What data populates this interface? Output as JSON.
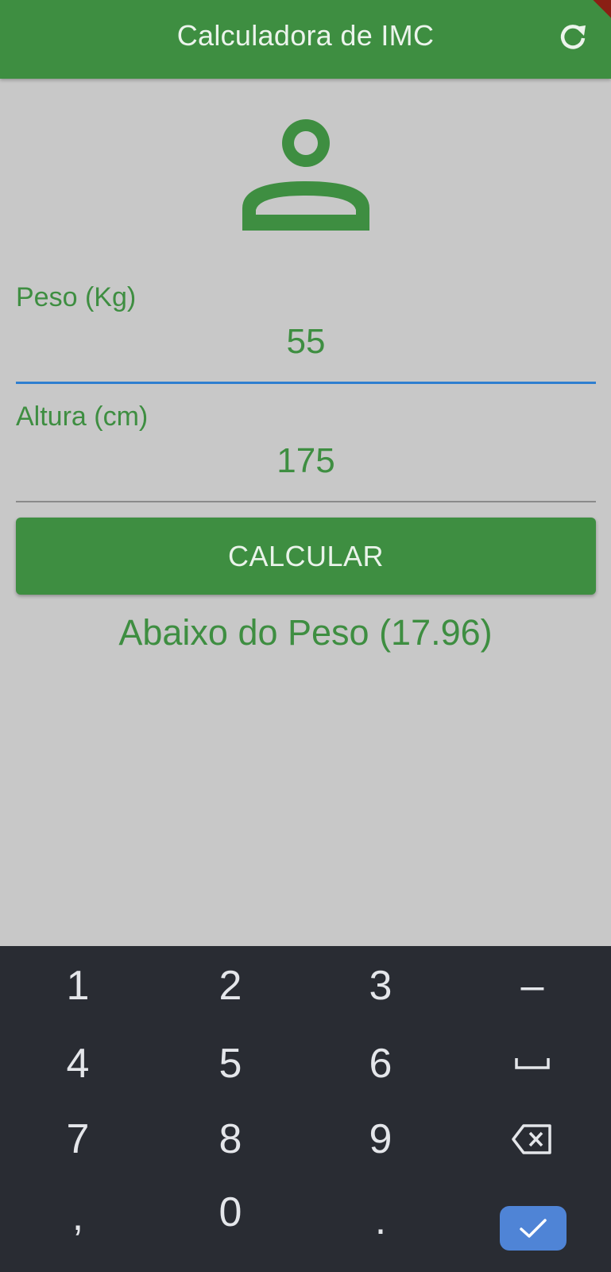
{
  "appbar": {
    "title": "Calculadora de IMC",
    "refresh_icon": "refresh-icon",
    "color": "#3e8e41"
  },
  "avatar_icon": "person-outline-icon",
  "form": {
    "weight": {
      "label": "Peso (Kg)",
      "value": "55"
    },
    "height": {
      "label": "Altura (cm)",
      "value": "175"
    },
    "calculate_label": "CALCULAR"
  },
  "result": {
    "text": "Abaixo do Peso (17.96)"
  },
  "keyboard": {
    "rows": [
      [
        "1",
        "2",
        "3",
        "–"
      ],
      [
        "4",
        "5",
        "6",
        "space"
      ],
      [
        "7",
        "8",
        "9",
        "backspace"
      ],
      [
        ",",
        "0",
        ".",
        "done"
      ]
    ],
    "keys": {
      "k1": "1",
      "k2": "2",
      "k3": "3",
      "minus": "–",
      "k4": "4",
      "k5": "5",
      "k6": "6",
      "k7": "7",
      "k8": "8",
      "k9": "9",
      "comma": ",",
      "k0": "0",
      "period": "."
    },
    "special_icons": [
      "space-icon",
      "backspace-icon",
      "check-icon"
    ],
    "done_color": "#4f84d6"
  }
}
